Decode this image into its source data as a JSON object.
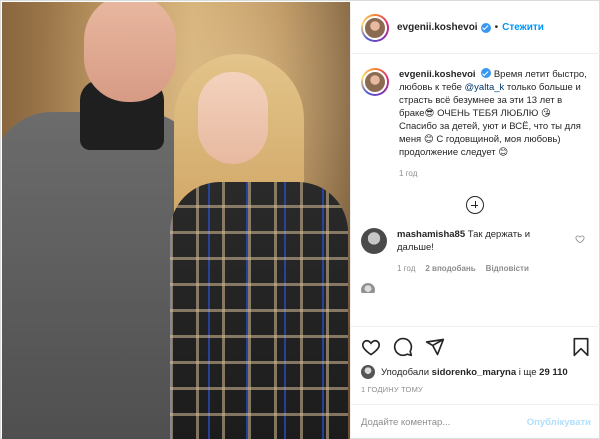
{
  "header": {
    "username": "evgenii.koshevoi",
    "separator": "•",
    "follow_label": "Стежити"
  },
  "caption": {
    "username": "evgenii.koshevoi",
    "text_before_mention": "Время летит быстро, любовь к тебе ",
    "mention": "@yalta_k",
    "text_after_mention": " только больше и страсть всё безумнее за эти 13 лет в браке😎 ОЧЕНЬ ТЕБЯ ЛЮБЛЮ 😘 Спасибо за детей, уют и ВСЁ, что ты для меня 😊 С годовщиной, моя любовь) продолжение следует 😊",
    "time": "1 год"
  },
  "comment": {
    "username": "mashamisha85",
    "text": "Так держать и дальше!",
    "time": "1 год",
    "likes": "2 вподобань",
    "reply": "Відповісти"
  },
  "likes": {
    "prefix": "Уподобали",
    "user": "sidorenko_maryna",
    "middle": "і ще",
    "count": "29 110"
  },
  "posted_ago": "1 ГОДИНУ ТОМУ",
  "add_comment": {
    "placeholder": "Додайте коментар...",
    "publish_label": "Опублікувати"
  },
  "colors": {
    "accent": "#0095f6",
    "mention": "#00376b",
    "muted": "#8e8e8e",
    "publish_disabled": "#b2dffc"
  }
}
